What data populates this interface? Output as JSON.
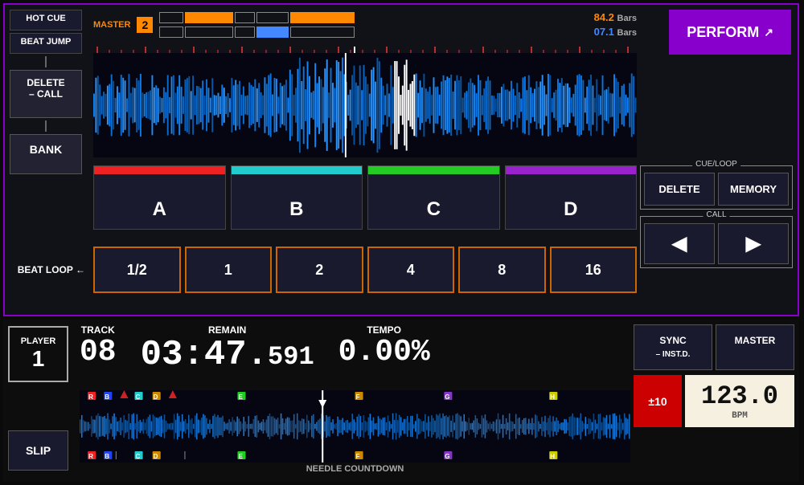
{
  "top_panel": {
    "master_label": "MASTER",
    "player_num": "2",
    "bars1_value": "84.2",
    "bars1_label": "Bars",
    "bars2_value": "07.1",
    "bars2_label": "Bars",
    "perform_label": "PERFORM"
  },
  "left_sidebar": {
    "hot_cue": "HOT CUE",
    "beat_jump": "BEAT JUMP",
    "delete_call": "DELETE\n– CALL",
    "bank": "BANK"
  },
  "abcd_buttons": [
    {
      "label": "A",
      "color": "#ee2222"
    },
    {
      "label": "B",
      "color": "#22cccc"
    },
    {
      "label": "C",
      "color": "#22cc22"
    },
    {
      "label": "D",
      "color": "#9922cc"
    }
  ],
  "beat_loop": {
    "label": "BEAT LOOP",
    "buttons": [
      "1/2",
      "1",
      "2",
      "4",
      "8",
      "16"
    ]
  },
  "cue_loop": {
    "section_label": "CUE/LOOP",
    "delete_label": "DELETE",
    "memory_label": "MEMORY"
  },
  "call": {
    "section_label": "CALL",
    "prev_label": "◀",
    "next_label": "▶"
  },
  "bottom": {
    "player_label": "PLAYER",
    "player_number": "1",
    "track_label": "TRACK",
    "track_value": "08",
    "remain_label": "REMAIN",
    "remain_value": "03:47.",
    "remain_ms": "591",
    "tempo_label": "TEMPO",
    "tempo_value": "0.00%",
    "needle_countdown": "NEEDLE COUNTDOWN",
    "slip_label": "SLIP",
    "sync_label": "SYNC\n– INST.D.",
    "master_label": "MASTER",
    "plusminus_label": "±10",
    "bpm_value": "123.0",
    "bpm_label": "BPM"
  }
}
